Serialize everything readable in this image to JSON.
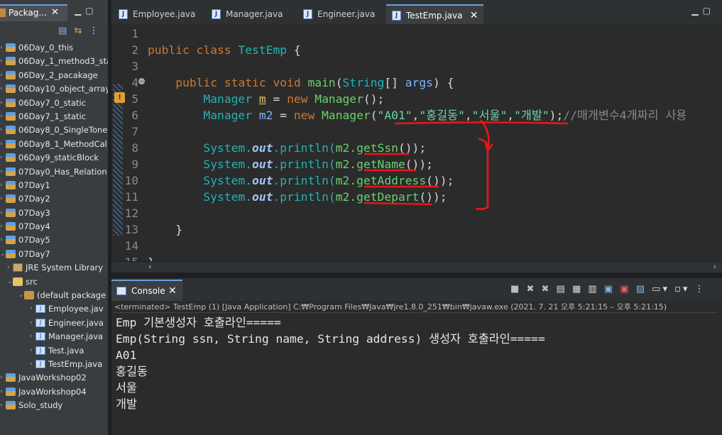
{
  "package_explorer": {
    "title": "Packag...",
    "items": [
      {
        "label": "06Day_0_this",
        "icon": "project-icon",
        "level": 0
      },
      {
        "label": "06Day_1_method3_sta",
        "icon": "project-icon",
        "level": 0
      },
      {
        "label": "06Day_2_pacakage",
        "icon": "project-icon",
        "level": 0
      },
      {
        "label": "06Day10_object_array",
        "icon": "project-icon",
        "level": 0
      },
      {
        "label": "06Day7_0_static",
        "icon": "project-icon",
        "level": 0
      },
      {
        "label": "06Day7_1_static",
        "icon": "project-icon",
        "level": 0
      },
      {
        "label": "06Day8_0_SingleTone",
        "icon": "project-icon",
        "level": 0
      },
      {
        "label": "06Day8_1_MethodCal",
        "icon": "project-icon",
        "level": 0
      },
      {
        "label": "06Day9_staticBlock",
        "icon": "project-icon",
        "level": 0
      },
      {
        "label": "07Day0_Has_Relation",
        "icon": "project-icon",
        "level": 0
      },
      {
        "label": "07Day1",
        "icon": "project-icon",
        "level": 0
      },
      {
        "label": "07Day2",
        "icon": "project-icon",
        "level": 0
      },
      {
        "label": "07Day3",
        "icon": "project-icon",
        "level": 0
      },
      {
        "label": "07Day4",
        "icon": "project-icon",
        "level": 0
      },
      {
        "label": "07Day5",
        "icon": "project-icon",
        "level": 0
      },
      {
        "label": "07Day7",
        "icon": "project-icon",
        "level": 0
      },
      {
        "label": "JRE System Library",
        "icon": "library-icon",
        "level": 1
      },
      {
        "label": "src",
        "icon": "source-folder-icon",
        "level": 1
      },
      {
        "label": "(default package",
        "icon": "package-icon",
        "level": 2
      },
      {
        "label": "Employee.jav",
        "icon": "java-file-icon",
        "level": 3
      },
      {
        "label": "Engineer.java",
        "icon": "java-file-icon",
        "level": 3
      },
      {
        "label": "Manager.java",
        "icon": "java-file-icon",
        "level": 3
      },
      {
        "label": "Test.java",
        "icon": "java-file-icon",
        "level": 3
      },
      {
        "label": "TestEmp.java",
        "icon": "java-file-icon",
        "level": 3
      },
      {
        "label": "JavaWorkshop02",
        "icon": "project-icon",
        "level": 0
      },
      {
        "label": "JavaWorkshop04",
        "icon": "project-icon",
        "level": 0
      },
      {
        "label": "Solo_study",
        "icon": "project-icon",
        "level": 0
      }
    ]
  },
  "editor": {
    "tabs": [
      {
        "label": "Employee.java",
        "active": false
      },
      {
        "label": "Manager.java",
        "active": false
      },
      {
        "label": "Engineer.java",
        "active": false
      },
      {
        "label": "TestEmp.java",
        "active": true
      }
    ],
    "line_numbers": [
      "1",
      "2",
      "3",
      "4",
      "5",
      "6",
      "7",
      "8",
      "9",
      "10",
      "11",
      "12",
      "13",
      "14",
      "15"
    ],
    "code": {
      "l2_kw": "public class ",
      "l2_cls": "TestEmp",
      "l2_rest": " {",
      "l4_kw": "public static void ",
      "l4_fn": "main",
      "l4_p1": "(",
      "l4_ty": "String",
      "l4_p2": "[] ",
      "l4_arg": "args",
      "l4_p3": ") {",
      "l5_ty": "Manager ",
      "l5_var": "m",
      "l5_eq": " = ",
      "l5_new": "new ",
      "l5_fn": "Manager",
      "l5_rest": "();",
      "l6_ty": "Manager ",
      "l6_var": "m2",
      "l6_eq": " = ",
      "l6_new": "new ",
      "l6_fn": "Manager",
      "l6_p1": "(",
      "l6_s1": "\"A01\"",
      "l6_c1": ",",
      "l6_s2": "\"홍길동\"",
      "l6_c2": ",",
      "l6_s3": "\"서울\"",
      "l6_c3": ",",
      "l6_s4": "\"개발\"",
      "l6_p2": ");",
      "l6_cm": "//매개변수4개짜리 사용",
      "print_sys": "System.",
      "print_out": "out",
      "print_mid": ".println(",
      "print_obj": "m2.",
      "l8_m": "getSsn",
      "l9_m": "getName",
      "l10_m": "getAddress",
      "l11_m": "getDepart",
      "print_end": "());",
      "l13": "}"
    }
  },
  "console": {
    "title": "Console",
    "status": "<terminated> TestEmp (1) [Java Application] C:₩Program Files₩Java₩jre1.8.0_251₩bin₩javaw.exe  (2021. 7. 21 오후 5:21:15 – 오후 5:21:15)",
    "output": [
      "Emp 기본생성자 호출라인=====",
      "Emp(String ssn, String name, String address) 생성자 호출라인=====",
      "A01",
      "홍길동",
      "서울",
      "개발"
    ]
  },
  "colors": {
    "annotation": "#e8161b",
    "keyword": "#cc7832",
    "type": "#1eb5b5",
    "string": "#6ed6a4"
  }
}
